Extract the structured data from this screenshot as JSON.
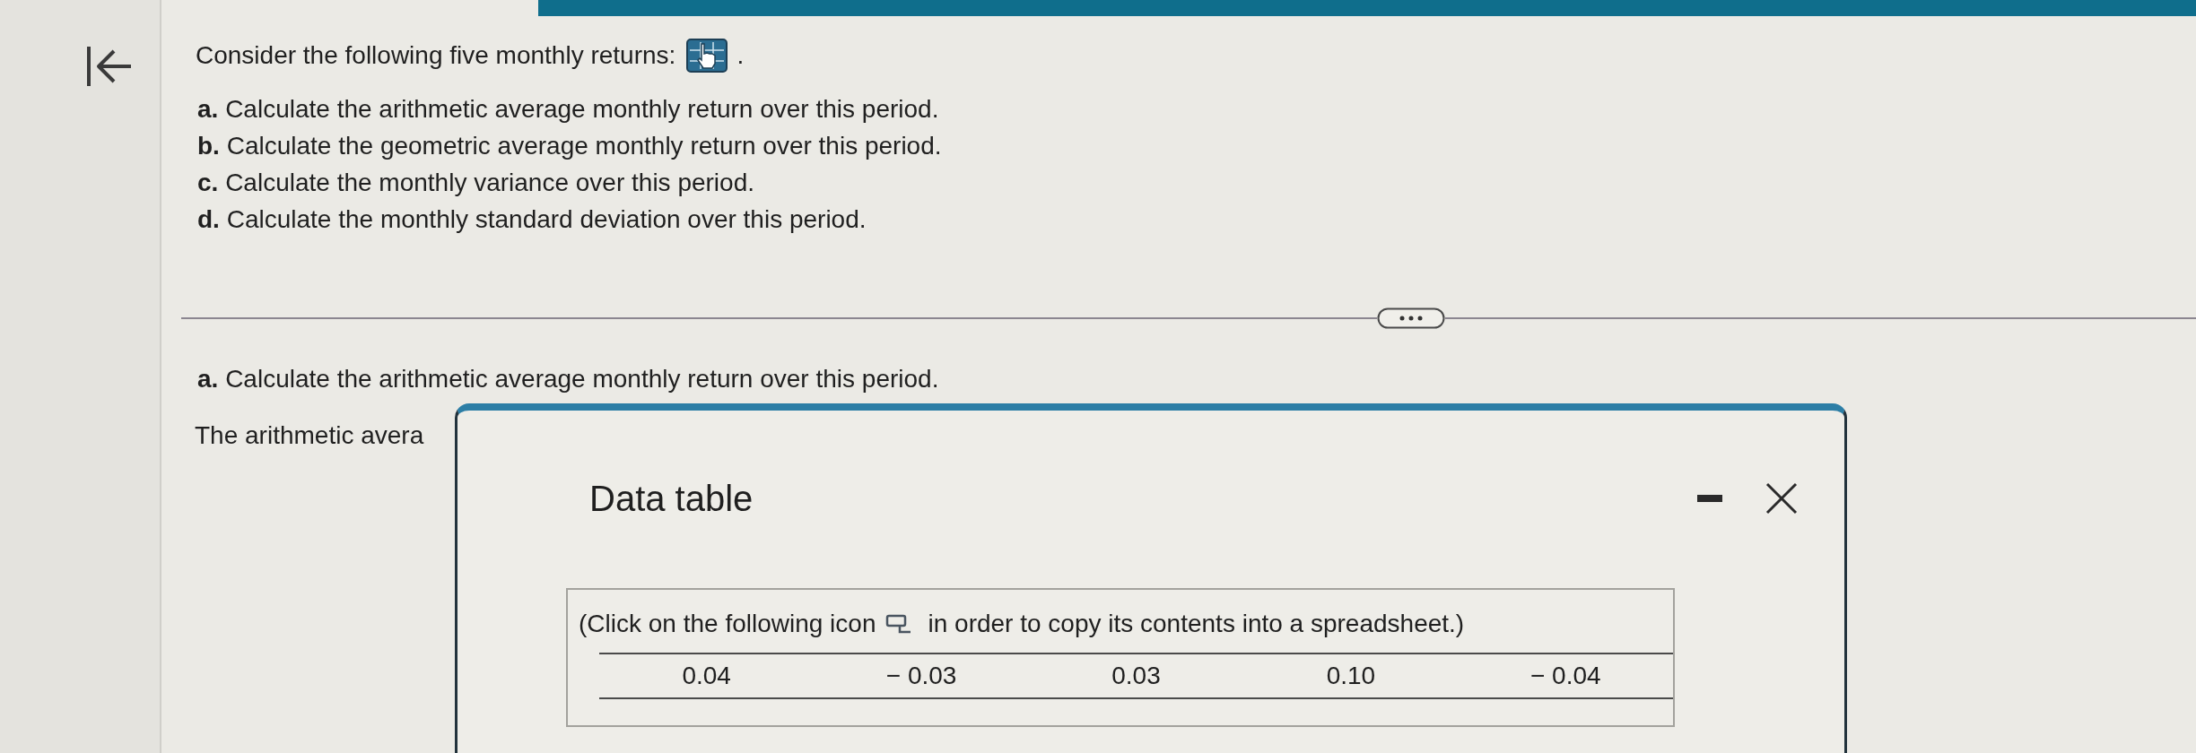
{
  "question": {
    "intro": "Consider the following five monthly returns:",
    "intro_end": ".",
    "parts": [
      "**a.** Calculate the arithmetic average monthly return over this period.",
      "**b.** Calculate the geometric average monthly return over this period.",
      "**c.** Calculate the monthly variance over this period.",
      "**d.** Calculate the monthly standard deviation over this period."
    ]
  },
  "answer_section": {
    "heading": "**a.** Calculate the arithmetic average monthly return over this period.",
    "prompt": "The arithmetic avera"
  },
  "dialog": {
    "title": "Data table",
    "instruction_before": "(Click on the following icon",
    "instruction_after": "in order to copy its contents into a spreadsheet.)",
    "values": [
      "0.04",
      "− 0.03",
      "0.03",
      "0.10",
      "− 0.04"
    ]
  }
}
